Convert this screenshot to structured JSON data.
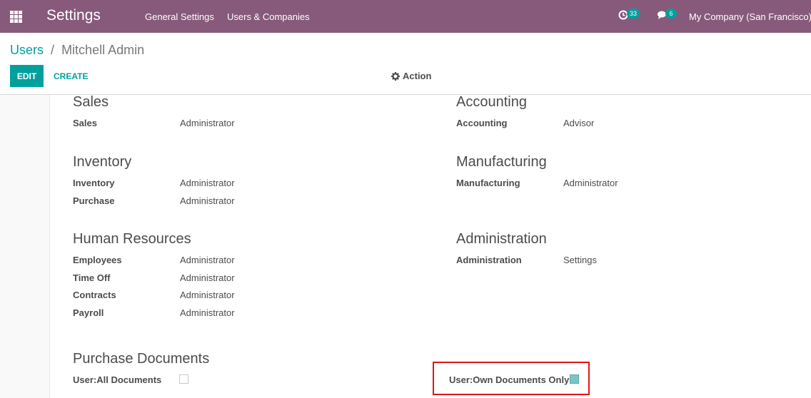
{
  "navbar": {
    "app_title": "Settings",
    "menu": [
      "General Settings",
      "Users & Companies"
    ],
    "activity_count": "33",
    "message_count": "6",
    "company": "My Company (San Francisco)"
  },
  "breadcrumb": {
    "parent": "Users",
    "separator": "/",
    "current": "Mitchell Admin"
  },
  "buttons": {
    "edit": "EDIT",
    "create": "CREATE",
    "action": "Action"
  },
  "sections": {
    "sales": {
      "title": "Sales",
      "fields": [
        {
          "label": "Sales",
          "value": "Administrator"
        }
      ]
    },
    "accounting": {
      "title": "Accounting",
      "fields": [
        {
          "label": "Accounting",
          "value": "Advisor"
        }
      ]
    },
    "inventory": {
      "title": "Inventory",
      "fields": [
        {
          "label": "Inventory",
          "value": "Administrator"
        },
        {
          "label": "Purchase",
          "value": "Administrator"
        }
      ]
    },
    "manufacturing": {
      "title": "Manufacturing",
      "fields": [
        {
          "label": "Manufacturing",
          "value": "Administrator"
        }
      ]
    },
    "human_resources": {
      "title": "Human Resources",
      "fields": [
        {
          "label": "Employees",
          "value": "Administrator"
        },
        {
          "label": "Time Off",
          "value": "Administrator"
        },
        {
          "label": "Contracts",
          "value": "Administrator"
        },
        {
          "label": "Payroll",
          "value": "Administrator"
        }
      ]
    },
    "administration": {
      "title": "Administration",
      "fields": [
        {
          "label": "Administration",
          "value": "Settings"
        }
      ]
    },
    "purchase_documents": {
      "title": "Purchase Documents",
      "all_documents_label": "User:All Documents",
      "all_documents_checked": false,
      "own_documents_label": "User:Own Documents Only",
      "own_documents_checked": true
    }
  },
  "colors": {
    "navbar": "#875a7b",
    "accent": "#00a09d",
    "highlight": "#e0151a"
  }
}
